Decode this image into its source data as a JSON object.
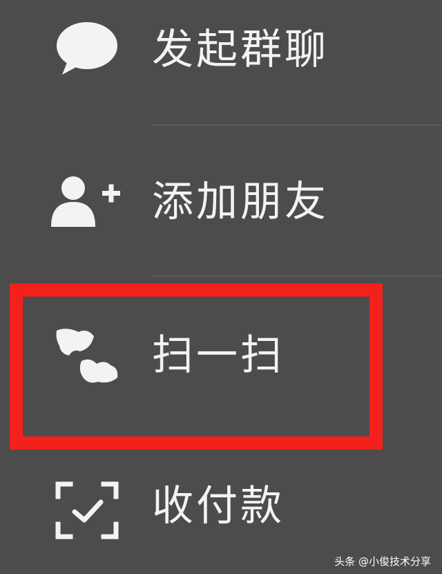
{
  "menu": {
    "items": [
      {
        "icon": "chat-bubble-icon",
        "label": "发起群聊"
      },
      {
        "icon": "add-friend-icon",
        "label": "添加朋友"
      },
      {
        "icon": "scan-icon",
        "label": "扫一扫"
      },
      {
        "icon": "money-scan-icon",
        "label": "收付款"
      }
    ]
  },
  "highlight": {
    "color": "#f2211c",
    "target": "扫一扫"
  },
  "watermark": {
    "text": "头条 @小俊技术分享"
  },
  "colors": {
    "background": "#4c4c4c",
    "text": "#f3f3f3",
    "highlight": "#f2211c"
  }
}
